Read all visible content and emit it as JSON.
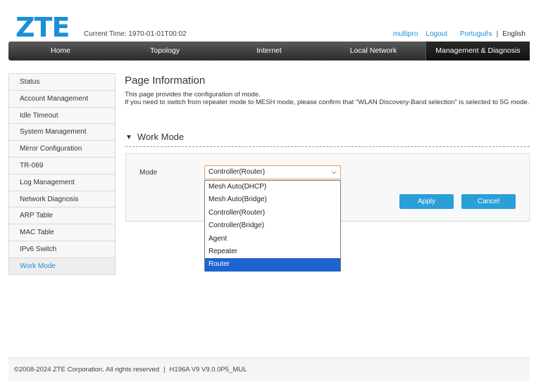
{
  "header": {
    "logo_text": "ZTE",
    "current_time_label": "Current Time: 1970-01-01T00:02",
    "user": "multipro",
    "logout_label": "Logout",
    "lang_portuguese": "Português",
    "lang_separator": "|",
    "lang_english": "English"
  },
  "nav": {
    "items": [
      "Home",
      "Topology",
      "Internet",
      "Local Network",
      "Management & Diagnosis"
    ],
    "active_index": 4
  },
  "sidebar": {
    "items": [
      "Status",
      "Account Management",
      "Idle Timeout",
      "System Management",
      "Mirror Configuration",
      "TR-069",
      "Log Management",
      "Network Diagnosis",
      "ARP Table",
      "MAC Table",
      "IPv6 Switch",
      "Work Mode"
    ],
    "active_index": 11
  },
  "main": {
    "page_title": "Page Information",
    "desc_line1": "This page provides the configuration of mode.",
    "desc_line2": "If you need to switch from repeater mode to MESH mode, please confirm that \"WLAN Discovery-Band selection\" is selected to 5G mode.",
    "section_title": "Work Mode",
    "mode_label": "Mode",
    "mode_value": "Controller(Router)",
    "mode_options": [
      "Mesh Auto(DHCP)",
      "Mesh Auto(Bridge)",
      "Controller(Router)",
      "Controller(Bridge)",
      "Agent",
      "Repeater",
      "Router"
    ],
    "highlighted_option_index": 6,
    "apply_label": "Apply",
    "cancel_label": "Cancel"
  },
  "footer": {
    "copyright": "©2008-2024 ZTE Corporation. All rights reserved",
    "separator": "|",
    "version": "H196A V9 V9.0.0P5_MUL"
  },
  "colors": {
    "brand": "#1a8fd8",
    "button": "#2a9fd8",
    "selected_option": "#1e63d0",
    "nav_bg": "#2b2b2b"
  }
}
